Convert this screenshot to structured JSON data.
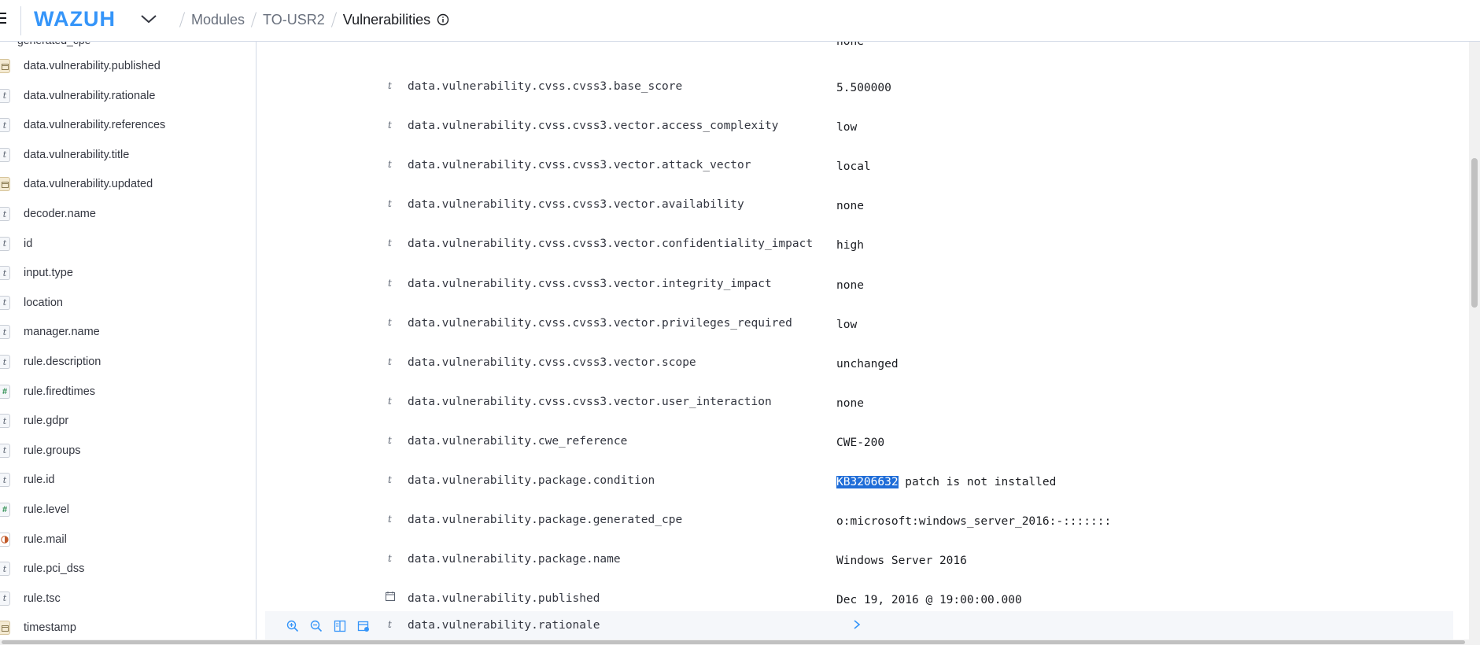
{
  "header": {
    "logo": "WAZUH",
    "breadcrumbs": [
      "Modules",
      "TO-USR2",
      "Vulnerabilities"
    ]
  },
  "sidebar": {
    "partial_top": "generated_cpe",
    "items": [
      {
        "label": "data.vulnerability.published",
        "type": "date"
      },
      {
        "label": "data.vulnerability.rationale",
        "type": "string"
      },
      {
        "label": "data.vulnerability.references",
        "type": "string"
      },
      {
        "label": "data.vulnerability.title",
        "type": "string"
      },
      {
        "label": "data.vulnerability.updated",
        "type": "date"
      },
      {
        "label": "decoder.name",
        "type": "string"
      },
      {
        "label": "id",
        "type": "string"
      },
      {
        "label": "input.type",
        "type": "string"
      },
      {
        "label": "location",
        "type": "string"
      },
      {
        "label": "manager.name",
        "type": "string"
      },
      {
        "label": "rule.description",
        "type": "string"
      },
      {
        "label": "rule.firedtimes",
        "type": "number"
      },
      {
        "label": "rule.gdpr",
        "type": "string"
      },
      {
        "label": "rule.groups",
        "type": "string"
      },
      {
        "label": "rule.id",
        "type": "string"
      },
      {
        "label": "rule.level",
        "type": "number"
      },
      {
        "label": "rule.mail",
        "type": "boolean"
      },
      {
        "label": "rule.pci_dss",
        "type": "string"
      },
      {
        "label": "rule.tsc",
        "type": "string"
      },
      {
        "label": "timestamp",
        "type": "date"
      }
    ],
    "type_glyphs": {
      "string": "t",
      "number": "#"
    }
  },
  "document": {
    "partial_top_value": "none",
    "rows": [
      {
        "field": "data.vulnerability.cvss.cvss3.base_score",
        "value": "5.500000",
        "type": "string"
      },
      {
        "field": "data.vulnerability.cvss.cvss3.vector.access_complexity",
        "value": "low",
        "type": "string"
      },
      {
        "field": "data.vulnerability.cvss.cvss3.vector.attack_vector",
        "value": "local",
        "type": "string"
      },
      {
        "field": "data.vulnerability.cvss.cvss3.vector.availability",
        "value": "none",
        "type": "string"
      },
      {
        "field": "data.vulnerability.cvss.cvss3.vector.confidentiality_impact",
        "value": "high",
        "type": "string"
      },
      {
        "field": "data.vulnerability.cvss.cvss3.vector.integrity_impact",
        "value": "none",
        "type": "string"
      },
      {
        "field": "data.vulnerability.cvss.cvss3.vector.privileges_required",
        "value": "low",
        "type": "string"
      },
      {
        "field": "data.vulnerability.cvss.cvss3.vector.scope",
        "value": "unchanged",
        "type": "string"
      },
      {
        "field": "data.vulnerability.cvss.cvss3.vector.user_interaction",
        "value": "none",
        "type": "string"
      },
      {
        "field": "data.vulnerability.cwe_reference",
        "value": "CWE-200",
        "type": "string"
      },
      {
        "field": "data.vulnerability.package.condition",
        "value_highlight": "KB3206632",
        "value_rest": " patch is not installed",
        "type": "string"
      },
      {
        "field": "data.vulnerability.package.generated_cpe",
        "value": "o:microsoft:windows_server_2016:-:::::::",
        "type": "string"
      },
      {
        "field": "data.vulnerability.package.name",
        "value": "Windows Server 2016",
        "type": "string"
      },
      {
        "field": "data.vulnerability.published",
        "value": "Dec 19, 2016 @ 19:00:00.000",
        "type": "date"
      }
    ],
    "last_row": {
      "field": "data.vulnerability.rationale",
      "type": "string"
    }
  }
}
